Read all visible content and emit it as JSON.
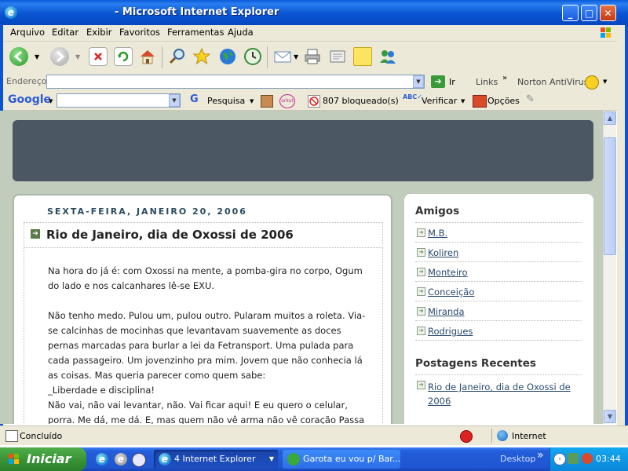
{
  "window": {
    "title": "- Microsoft Internet Explorer",
    "min": "_",
    "max": "□",
    "close": "✕"
  },
  "menu": [
    "Arquivo",
    "Editar",
    "Exibir",
    "Favoritos",
    "Ferramentas",
    "Ajuda"
  ],
  "address": {
    "label": "Endereço",
    "value": "",
    "go": "Ir",
    "links": "Links",
    "norton": "Norton AntiVirus"
  },
  "google": {
    "logo": "Google",
    "search": "Pesquisa",
    "blocked": "807 bloqueado(s)",
    "check": "Verificar",
    "options": "Opções",
    "orkut": "orkut"
  },
  "blog": {
    "date": "SEXTA-FEIRA, JANEIRO 20, 2006",
    "title": "Rio de Janeiro, dia de Oxossi de 2006",
    "body": [
      "Na hora do já é: com Oxossi na mente, a pomba-gira no corpo, Ogum do lado e nos calcanhares lê-se EXU.",
      "",
      "Não tenho medo. Pulou um, pulou outro. Pularam muitos a roleta. Via-se calcinhas de mocinhas que levantavam suavemente as doces pernas marcadas para burlar a lei da Fetransport. Uma pulada para cada passageiro. Um jovenzinho pra mim. Jovem que não conhecia lá as coisas. Mas queria parecer como quem sabe:",
      "_Liberdade e disciplina!",
      "Não vai, não vai levantar, não. Vai ficar aqui! E eu quero o celular, porra. Me dá, me dá. E, mas quem não vê arma não vê coração Passa"
    ],
    "sidebar": {
      "friends_title": "Amigos",
      "friends": [
        "M.B.",
        "Koliren",
        "Monteiro",
        "Conceição",
        "Miranda",
        "Rodrigues"
      ],
      "recent_title": "Postagens Recentes",
      "recent": [
        "Rio de Janeiro, dia de Oxossi de 2006"
      ]
    }
  },
  "status": {
    "text": "Concluído",
    "zone": "Internet"
  },
  "taskbar": {
    "start": "Iniciar",
    "tasks": [
      "4 Internet Explorer",
      "Garota eu vou p/ Bar..."
    ],
    "desktop": "Desktop",
    "clock": "03:44"
  }
}
